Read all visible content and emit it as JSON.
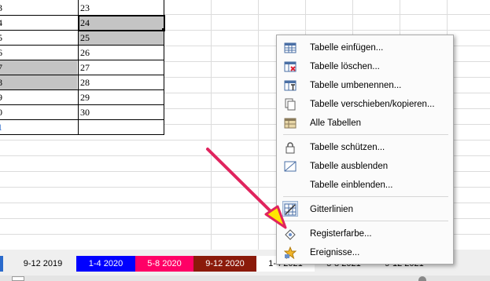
{
  "spreadsheet": {
    "left_fragments": [
      "3",
      "4",
      "5",
      "6",
      "7",
      "8",
      "9",
      "0",
      "1"
    ],
    "values": [
      "23",
      "24",
      "25",
      "26",
      "27",
      "28",
      "29",
      "30",
      ""
    ]
  },
  "sheet_tabs": [
    {
      "label": "9-12 2019",
      "bg": "#efefef",
      "fg": "#000000"
    },
    {
      "label": "1-4 2020",
      "bg": "#0000ff",
      "fg": "#ffffff"
    },
    {
      "label": "5-8 2020",
      "bg": "#ff0066",
      "fg": "#ffffff"
    },
    {
      "label": "9-12 2020",
      "bg": "#8b1a0a",
      "fg": "#ffffff"
    },
    {
      "label": "1-4 2021",
      "bg": "#ffffff",
      "fg": "#000000"
    },
    {
      "label": "5-8 2021",
      "bg": "#efefef",
      "fg": "#000000"
    },
    {
      "label": "9-12 2021",
      "bg": "#efefef",
      "fg": "#000000"
    }
  ],
  "context_menu": {
    "items": [
      {
        "label": "Tabelle einfügen...",
        "icon": "insert-sheet-icon"
      },
      {
        "label": "Tabelle löschen...",
        "icon": "delete-sheet-icon"
      },
      {
        "label": "Tabelle umbenennen...",
        "icon": "rename-sheet-icon"
      },
      {
        "label": "Tabelle verschieben/kopieren...",
        "icon": "copy-sheet-icon"
      },
      {
        "label": "Alle Tabellen",
        "icon": "all-sheets-icon"
      },
      {
        "label": "Tabelle schützen...",
        "icon": "lock-icon"
      },
      {
        "label": "Tabelle ausblenden",
        "icon": "hide-sheet-icon"
      },
      {
        "label": "Tabelle einblenden...",
        "icon": ""
      },
      {
        "label": "Gitterlinien",
        "icon": "gridlines-icon"
      },
      {
        "label": "Registerfarbe...",
        "icon": "tab-color-icon"
      },
      {
        "label": "Ereignisse...",
        "icon": "events-star-icon"
      }
    ]
  },
  "annotation": {
    "arrow_color": "#e0245e",
    "arrowhead_fill": "#ffe600"
  }
}
